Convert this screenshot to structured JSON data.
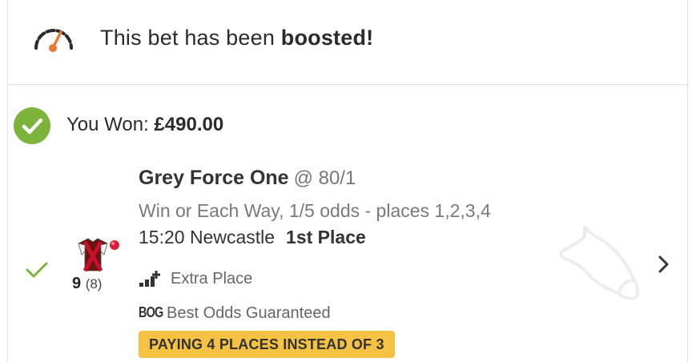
{
  "boost": {
    "icon": "speedometer-icon",
    "text_prefix": "This bet has been ",
    "text_bold": "boosted!"
  },
  "result": {
    "icon": "check-circle-icon",
    "label": "You Won: ",
    "amount": "£490.00"
  },
  "selection": {
    "status_icon": "check-icon",
    "silks_icon": "jockey-silks-icon",
    "runner_number": "9",
    "draw": "(8)",
    "horse_name": "Grey Force One",
    "odds": "@ 80/1",
    "market": "Win or Each Way, 1/5 odds - places 1,2,3,4",
    "race_time_course": "15:20 Newcastle",
    "finish": "1st Place",
    "features": [
      {
        "icon": "extra-place-icon",
        "label": "Extra Place"
      },
      {
        "icon": "BOG",
        "label": "Best Odds Guaranteed"
      }
    ],
    "badge": "PAYING 4 PLACES INSTEAD OF 3",
    "watermark_icon": "horse-head-icon",
    "nav_icon": "chevron-right-icon"
  },
  "colors": {
    "success_green": "#7cb43b",
    "boost_orange": "#e8793a",
    "badge_yellow": "#f5c243",
    "silks_red": "#c8102e"
  }
}
